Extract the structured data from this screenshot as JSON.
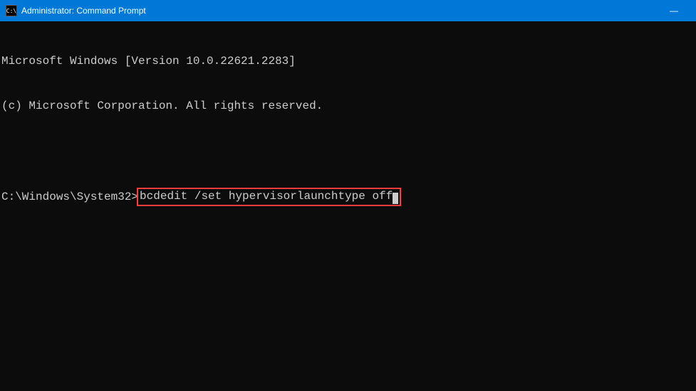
{
  "titlebar": {
    "icon_text": "C:\\",
    "title": "Administrator: Command Prompt",
    "minimize": "—"
  },
  "terminal": {
    "line1": "Microsoft Windows [Version 10.0.22621.2283]",
    "line2": "(c) Microsoft Corporation. All rights reserved.",
    "prompt": "C:\\Windows\\System32>",
    "command": "bcdedit /set hypervisorlaunchtype off"
  }
}
